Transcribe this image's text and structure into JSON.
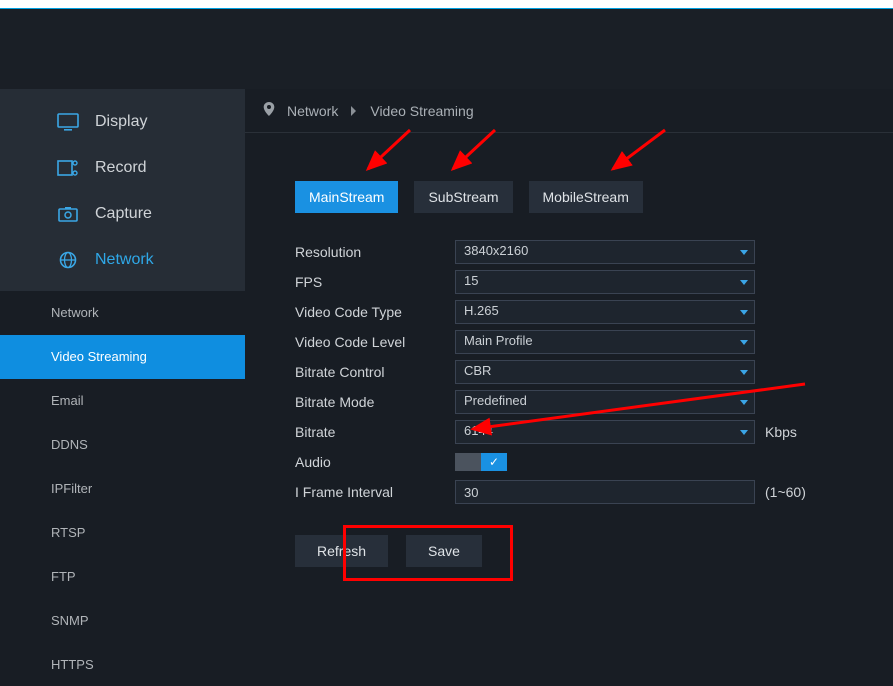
{
  "sidebar": {
    "main": [
      {
        "label": "Display",
        "icon": "display"
      },
      {
        "label": "Record",
        "icon": "record"
      },
      {
        "label": "Capture",
        "icon": "capture"
      },
      {
        "label": "Network",
        "icon": "network",
        "active": true
      }
    ],
    "sub": [
      {
        "label": "Network"
      },
      {
        "label": "Video Streaming",
        "active": true
      },
      {
        "label": "Email"
      },
      {
        "label": "DDNS"
      },
      {
        "label": "IPFilter"
      },
      {
        "label": "RTSP"
      },
      {
        "label": "FTP"
      },
      {
        "label": "SNMP"
      },
      {
        "label": "HTTPS"
      }
    ]
  },
  "breadcrumb": {
    "root": "Network",
    "leaf": "Video Streaming"
  },
  "tabs": [
    {
      "label": "MainStream",
      "active": true
    },
    {
      "label": "SubStream"
    },
    {
      "label": "MobileStream"
    }
  ],
  "fields": {
    "resolution": {
      "label": "Resolution",
      "value": "3840x2160"
    },
    "fps": {
      "label": "FPS",
      "value": "15"
    },
    "codetype": {
      "label": "Video Code Type",
      "value": "H.265"
    },
    "codelevel": {
      "label": "Video Code Level",
      "value": "Main Profile"
    },
    "bitctrl": {
      "label": "Bitrate Control",
      "value": "CBR"
    },
    "bitmode": {
      "label": "Bitrate Mode",
      "value": "Predefined"
    },
    "bitrate": {
      "label": "Bitrate",
      "value": "6144",
      "unit": "Kbps"
    },
    "audio": {
      "label": "Audio",
      "on": true
    },
    "iframe": {
      "label": "I Frame Interval",
      "value": "30",
      "hint": "(1~60)"
    }
  },
  "buttons": {
    "refresh": "Refresh",
    "save": "Save"
  }
}
